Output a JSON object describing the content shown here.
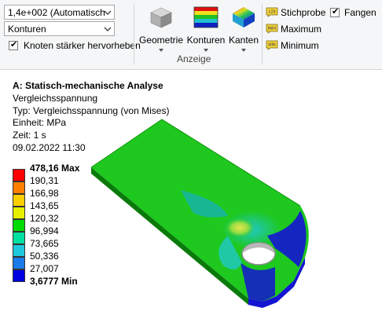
{
  "toolbar": {
    "scale_combo": {
      "value": "1,4e+002 (Automatisch"
    },
    "display_combo": {
      "value": "Konturen"
    },
    "highlight_nodes": {
      "label": "Knoten stärker hervorheben",
      "checked": true
    },
    "geometry_button": {
      "label": "Geometrie",
      "icon": "geometry-cube-icon"
    },
    "contours_button": {
      "label": "Konturen",
      "icon": "contour-bands-icon"
    },
    "edges_button": {
      "label": "Kanten",
      "icon": "edges-gradient-icon"
    },
    "group_label": "Anzeige",
    "probe_button": {
      "label": "Stichprobe",
      "icon": "probe-icon",
      "icon_text": "123"
    },
    "snap_check": {
      "label": "Fangen",
      "checked": true
    },
    "maximum_button": {
      "label": "Maximum",
      "icon": "max-icon",
      "icon_text": "MAX"
    },
    "minimum_button": {
      "label": "Minimum",
      "icon": "min-icon",
      "icon_text": "MIN"
    }
  },
  "info": {
    "title": "A: Statisch-mechanische Analyse",
    "result_name": "Vergleichsspannung",
    "type": "Typ: Vergleichsspannung (von Mises)",
    "unit": "Einheit: MPa",
    "time": "Zeit: 1 s",
    "date": "09.02.2022 11:30"
  },
  "legend": {
    "max_label": "478,16 Max",
    "min_label": "3,6777 Min",
    "values": [
      "190,31",
      "166,98",
      "143,65",
      "120,32",
      "96,994",
      "73,665",
      "50,336",
      "27,007"
    ],
    "colors": [
      "#ff0000",
      "#ff8000",
      "#ffd000",
      "#e6f000",
      "#00dc00",
      "#00e0a0",
      "#20c8dc",
      "#1a7ce8",
      "#0000e0"
    ]
  },
  "model": {
    "colors": {
      "base": "#1ec81e",
      "edge": "#0a7a0a",
      "cyan": "#20c8c8",
      "blue": "#1414d2",
      "teal": "#18b4a8",
      "yellow": "#e6e650"
    }
  }
}
